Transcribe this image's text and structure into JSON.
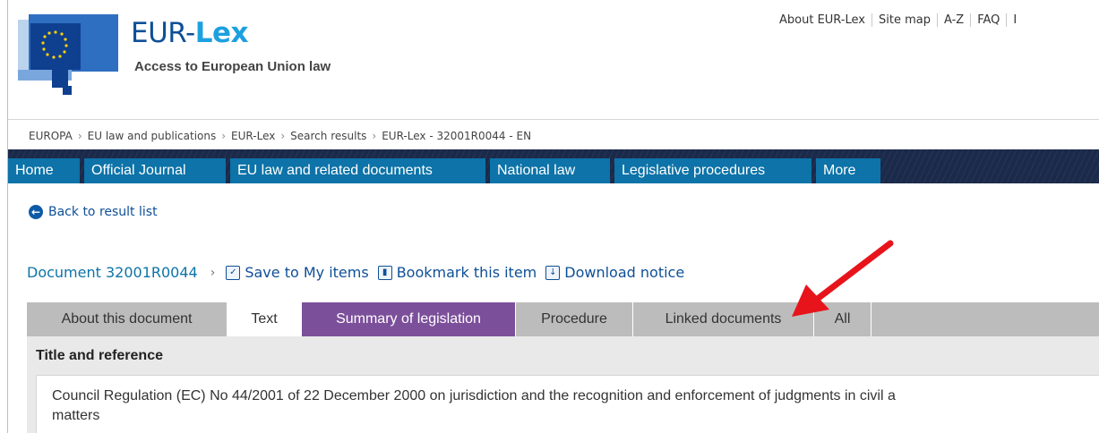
{
  "header": {
    "brand_prefix": "EUR-",
    "brand_strong": "Lex",
    "tagline": "Access to European Union law",
    "top_links": [
      "About EUR-Lex",
      "Site map",
      "A-Z",
      "FAQ",
      "I"
    ]
  },
  "breadcrumb": [
    "EUROPA",
    "EU law and publications",
    "EUR-Lex",
    "Search results",
    "EUR-Lex - 32001R0044 - EN"
  ],
  "nav": [
    "Home",
    "Official Journal",
    "EU law and related documents",
    "National law",
    "Legislative procedures",
    "More"
  ],
  "back_link": "Back to result list",
  "document": {
    "id_label": "Document 32001R0044",
    "actions": [
      "Save to My items",
      "Bookmark this item",
      "Download notice"
    ]
  },
  "tabs": [
    "About this document",
    "Text",
    "Summary of legislation",
    "Procedure",
    "Linked documents",
    "All"
  ],
  "content": {
    "section_title": "Title and reference",
    "line1": "Council Regulation (EC) No 44/2001 of 22 December 2000 on jurisdiction and the recognition and enforcement of judgments in civil a",
    "line2": "matters"
  },
  "colors": {
    "nav_bg": "#1b2a4a",
    "nav_tab": "#0d73a8",
    "summary_tab": "#7c4f9b",
    "annotation_arrow": "#e8141b"
  }
}
